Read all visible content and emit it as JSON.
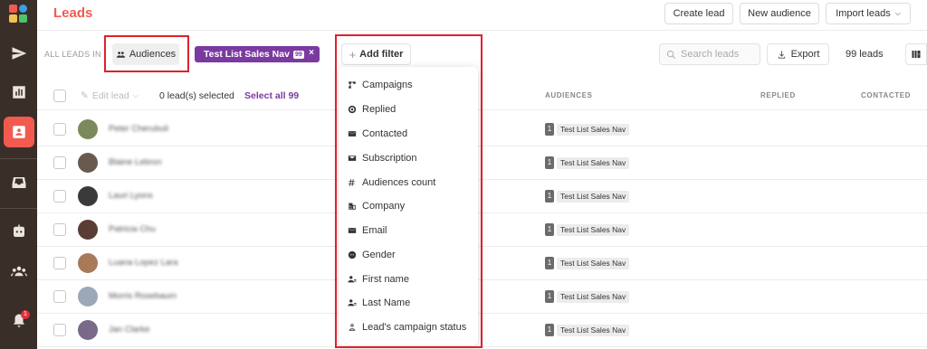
{
  "page": {
    "title": "Leads"
  },
  "header": {
    "create_lead": "Create lead",
    "new_audience": "New audience",
    "import_leads": "Import leads"
  },
  "toolbar": {
    "all_leads_in": "ALL LEADS IN",
    "audiences": "Audiences",
    "chip": {
      "label": "Test List Sales Nav",
      "count": "99",
      "remove": "×"
    },
    "add_filter": "Add filter",
    "search_placeholder": "Search leads",
    "export": "Export",
    "lead_count": "99 leads"
  },
  "table": {
    "edit_lead": "Edit lead",
    "selected_text": "0 lead(s) selected",
    "select_all": "Select all 99",
    "columns": [
      "AUDIENCES",
      "REPLIED",
      "CONTACTED"
    ],
    "rows": [
      {
        "name": "Peter Cherubuli",
        "aud_count": "1",
        "aud_name": "Test List Sales Nav",
        "avatar": "#7a8a5a"
      },
      {
        "name": "Blaine Lebron",
        "aud_count": "1",
        "aud_name": "Test List Sales Nav",
        "avatar": "#6a5a4e"
      },
      {
        "name": "Lauri Lyons",
        "aud_count": "1",
        "aud_name": "Test List Sales Nav",
        "avatar": "#3a3a3a"
      },
      {
        "name": "Patricia Chu",
        "aud_count": "1",
        "aud_name": "Test List Sales Nav",
        "avatar": "#5a3d35"
      },
      {
        "name": "Luana Lopez Lara",
        "aud_count": "1",
        "aud_name": "Test List Sales Nav",
        "avatar": "#a87a5a"
      },
      {
        "name": "Morris Rosebaum",
        "aud_count": "1",
        "aud_name": "Test List Sales Nav",
        "avatar": "#9aa8b8"
      },
      {
        "name": "Jan Clarke",
        "aud_count": "1",
        "aud_name": "Test List Sales Nav",
        "avatar": "#7a6a8a"
      }
    ]
  },
  "filter_menu": {
    "items": [
      {
        "label": "Campaigns",
        "icon": "campaigns-icon"
      },
      {
        "label": "Replied",
        "icon": "replied-icon"
      },
      {
        "label": "Contacted",
        "icon": "contacted-icon"
      },
      {
        "label": "Subscription",
        "icon": "subscription-icon"
      },
      {
        "label": "Audiences count",
        "icon": "hash-icon"
      },
      {
        "label": "Company",
        "icon": "company-icon"
      },
      {
        "label": "Email",
        "icon": "email-icon"
      },
      {
        "label": "Gender",
        "icon": "gender-icon"
      },
      {
        "label": "First name",
        "icon": "person-icon"
      },
      {
        "label": "Last Name",
        "icon": "person-icon"
      },
      {
        "label": "Lead's campaign status",
        "icon": "person-outline-icon"
      }
    ]
  },
  "sidebar": {
    "notification_count": "1"
  },
  "colors": {
    "accent": "#f25a4f",
    "sidebar": "#3a2e28",
    "chip": "#7b3aa0",
    "highlight": "#e0202c"
  }
}
